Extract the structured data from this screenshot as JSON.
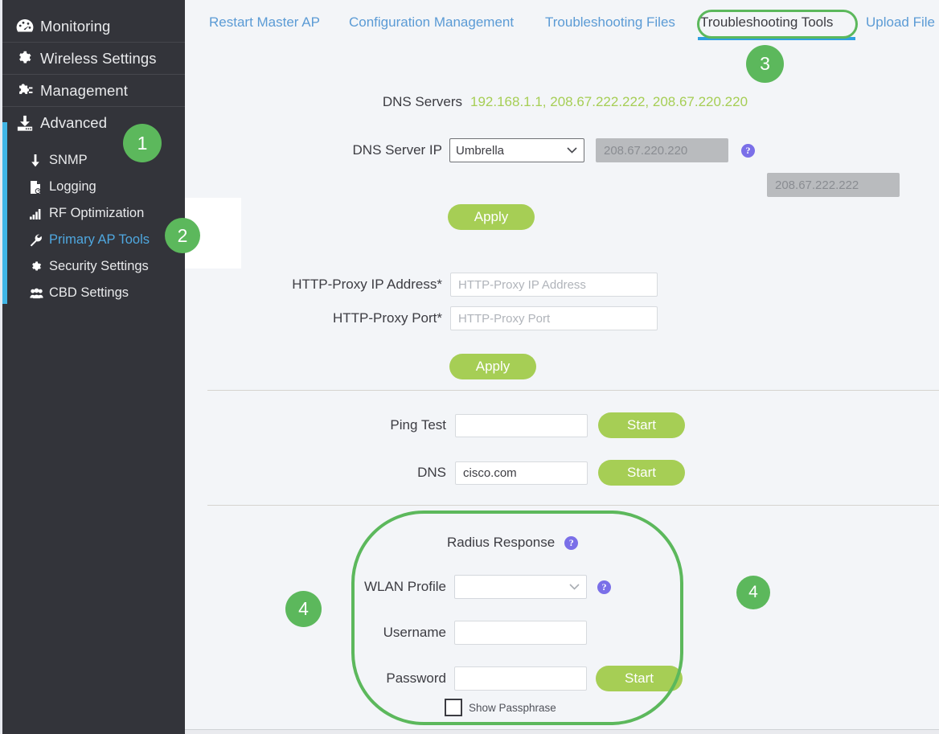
{
  "sidebar": {
    "main_items": [
      {
        "label": "Monitoring",
        "icon": "dashboard-icon"
      },
      {
        "label": "Wireless Settings",
        "icon": "gear-icon"
      },
      {
        "label": "Management",
        "icon": "puzzle-icon"
      },
      {
        "label": "Advanced",
        "icon": "download-icon"
      }
    ],
    "sub_items": [
      {
        "label": "SNMP",
        "icon": "down-arrow-icon",
        "active": false
      },
      {
        "label": "Logging",
        "icon": "document-icon",
        "active": false
      },
      {
        "label": "RF Optimization",
        "icon": "bar-chart-icon",
        "active": false
      },
      {
        "label": "Primary AP Tools",
        "icon": "wrench-icon",
        "active": true
      },
      {
        "label": "Security Settings",
        "icon": "gear-icon",
        "active": false
      },
      {
        "label": "CBD Settings",
        "icon": "users-icon",
        "active": false
      }
    ]
  },
  "tabs": [
    {
      "label": "Restart Master AP",
      "selected": false
    },
    {
      "label": "Configuration Management",
      "selected": false
    },
    {
      "label": "Troubleshooting Files",
      "selected": false
    },
    {
      "label": "Troubleshooting Tools",
      "selected": true
    },
    {
      "label": "Upload File",
      "selected": false
    }
  ],
  "dns_section": {
    "servers_label": "DNS Servers",
    "servers_value": "192.168.1.1, 208.67.222.222, 208.67.220.220",
    "server_ip_label": "DNS Server IP",
    "server_ip_selected": "Umbrella",
    "server_ip_options": [
      "Umbrella"
    ],
    "primary_ip_value": "208.67.220.220",
    "secondary_ip_value": "208.67.222.222",
    "apply_label": "Apply",
    "help_glyph": "?"
  },
  "proxy_section": {
    "ip_label": "HTTP-Proxy IP Address*",
    "ip_placeholder": "HTTP-Proxy IP Address",
    "ip_value": "",
    "port_label": "HTTP-Proxy Port*",
    "port_placeholder": "HTTP-Proxy Port",
    "port_value": "",
    "apply_label": "Apply"
  },
  "tests_section": {
    "ping_label": "Ping Test",
    "ping_value": "",
    "ping_start_label": "Start",
    "dns_label": "DNS",
    "dns_value": "cisco.com",
    "dns_start_label": "Start"
  },
  "radius_section": {
    "title": "Radius Response",
    "title_help_glyph": "?",
    "wlan_label": "WLAN Profile",
    "wlan_selected": "",
    "wlan_options": [
      ""
    ],
    "wlan_help_glyph": "?",
    "username_label": "Username",
    "username_value": "",
    "password_label": "Password",
    "password_value": "",
    "start_label": "Start",
    "show_passphrase_label": "Show Passphrase",
    "show_passphrase_checked": false
  },
  "annotations": {
    "badges": [
      {
        "number": "1"
      },
      {
        "number": "2"
      },
      {
        "number": "3"
      },
      {
        "number": "4"
      },
      {
        "number": "4"
      }
    ],
    "accent_color": "#5cb85c"
  },
  "colors": {
    "sidebar_bg": "#33343a",
    "sidebar_accent": "#41b6e6",
    "link_blue": "#5b9bd5",
    "button_green": "#a6ce55",
    "annotation_green": "#5cb85c",
    "help_purple": "#7a6fe8",
    "page_bg": "#f3f5f8"
  }
}
